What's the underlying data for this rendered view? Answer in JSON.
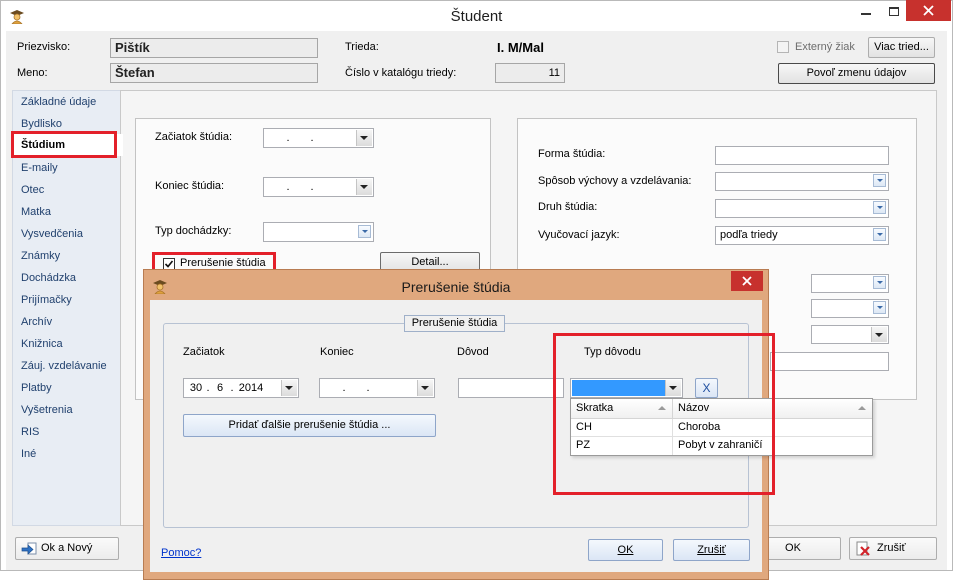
{
  "main_window": {
    "title": "Študent",
    "icons": {
      "app": "student-app-icon",
      "minimize": "minimize-icon",
      "maximize": "maximize-icon",
      "close": "close-icon"
    }
  },
  "header": {
    "surname": {
      "label": "Priezvisko:",
      "value": "Pištík"
    },
    "first_name": {
      "label": "Meno:",
      "value": "Štefan"
    },
    "class": {
      "label": "Trieda:",
      "value": "I. M/Mal"
    },
    "catalog_number": {
      "label": "Číslo v katalógu triedy:",
      "value": "11"
    },
    "external_student": {
      "label": "Externý žiak",
      "checked": false,
      "enabled": false
    },
    "more_classes_button": "Viac tried...",
    "allow_edit_button": "Povoľ zmenu údajov"
  },
  "sidebar": {
    "selected_index": 2,
    "items": [
      "Základné údaje",
      "Bydlisko",
      "Štúdium",
      "E-maily",
      "Otec",
      "Matka",
      "Vysvedčenia",
      "Známky",
      "Dochádzka",
      "Prijímačky",
      "Archív",
      "Knižnica",
      "Záuj. vzdelávanie",
      "Platby",
      "Vyšetrenia",
      "RIS",
      "Iné"
    ]
  },
  "study": {
    "start": {
      "label": "Začiatok štúdia:",
      "day": "",
      "month": "",
      "year": "",
      "separator": "."
    },
    "end": {
      "label": "Koniec štúdia:",
      "day": "",
      "month": "",
      "year": "",
      "separator": "."
    },
    "attendance": {
      "label": "Typ dochádzky:",
      "value": ""
    },
    "interruption": {
      "label": "Prerušenie štúdia",
      "checked": true
    },
    "detail_button": "Detail...",
    "form": {
      "label": "Forma štúdia:",
      "value": ""
    },
    "upbringing": {
      "label": "Spôsob výchovy a vzdelávania:",
      "value": ""
    },
    "study_type": {
      "label": "Druh štúdia:",
      "value": ""
    },
    "language": {
      "label": "Vyučovací jazyk:",
      "value": "podľa triedy"
    },
    "hidden_fields": [
      "",
      "",
      "",
      ""
    ]
  },
  "footer": {
    "ok_new_button": "Ok a Nový",
    "ok_button": "OK",
    "cancel_button": "Zrušiť",
    "icons": {
      "ok_new": "ok-new-arrow-icon",
      "cancel": "cancel-x-icon"
    }
  },
  "dialog": {
    "title": "Prerušenie štúdia",
    "group_caption": "Prerušenie štúdia",
    "start_label": "Začiatok",
    "end_label": "Koniec",
    "reason_label": "Dôvod",
    "reason_type_label": "Typ dôvodu",
    "start": {
      "day": "30",
      "month": "6",
      "year": "2014",
      "separator": "."
    },
    "end": {
      "day": "",
      "month": "",
      "year": "",
      "separator": "."
    },
    "reason_value": "",
    "reason_type_value": "",
    "clear_button": "X",
    "dropdown": {
      "headers": [
        "Skratka",
        "Názov"
      ],
      "rows": [
        [
          "CH",
          "Choroba"
        ],
        [
          "PZ",
          "Pobyt v zahraničí"
        ]
      ]
    },
    "add_button": "Pridať ďalšie prerušenie štúdia ...",
    "help_link": "Pomoc?",
    "ok_button": "OK",
    "cancel_button": "Zrušiť"
  },
  "colors": {
    "annotation_red": "#e3202a",
    "dialog_frame": "#e0a87e",
    "selection_blue": "#3399ff",
    "close_red": "#c7312d",
    "nav_text": "#21416e"
  }
}
